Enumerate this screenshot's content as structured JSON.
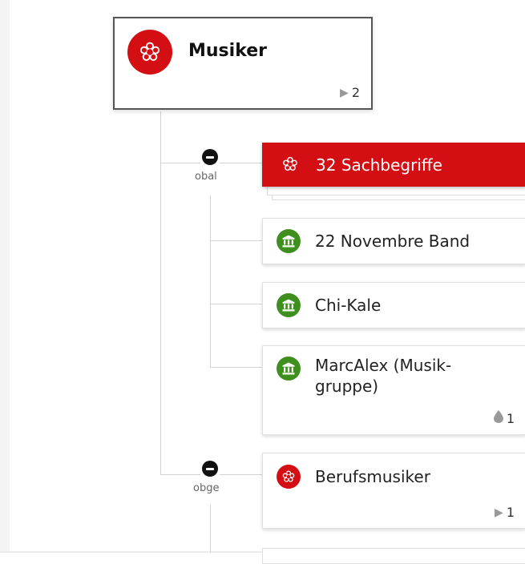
{
  "root": {
    "title": "Musiker",
    "count": "2"
  },
  "groups": [
    {
      "relation": "obal",
      "header": {
        "label": "32 Sachbegriffe"
      },
      "items": [
        {
          "label": "22 Novembre Band"
        },
        {
          "label": "Chi-Kale"
        },
        {
          "label": "MarcAlex (Musik-gruppe)",
          "line1": "MarcAlex (Musik-",
          "line2": "gruppe)",
          "count": "1"
        }
      ]
    },
    {
      "relation": "obge",
      "items": [
        {
          "label": "Berufsmusiker",
          "count": "1"
        }
      ]
    }
  ],
  "icons": {
    "concept": "asterisk-flower-icon",
    "institution": "building-columns-icon",
    "collapse": "minus-circle-icon",
    "expand": "play-triangle-icon",
    "drop": "drop-icon"
  },
  "colors": {
    "red": "#d40f14",
    "green": "#3f8f1f",
    "border": "#555555"
  }
}
